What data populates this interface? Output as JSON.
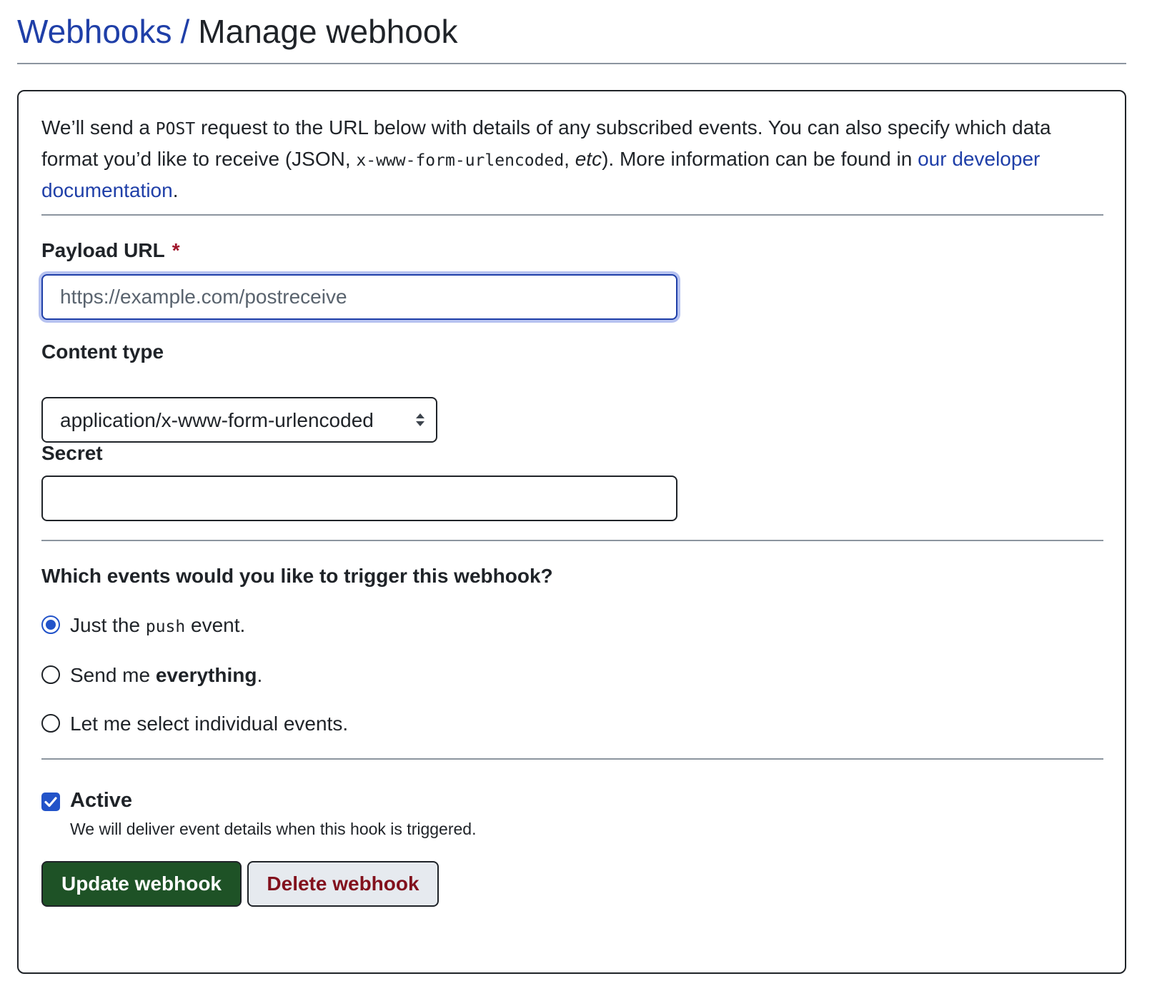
{
  "breadcrumb": {
    "parent": "Webhooks",
    "separator": "/",
    "current": "Manage webhook"
  },
  "intro": {
    "part1": "We’ll send a ",
    "code_method": "POST",
    "part2": " request to the URL below with details of any subscribed events. You can also specify which data format you’d like to receive (JSON, ",
    "code_format": "x-www-form-urlencoded",
    "part3": ", ",
    "etc": "etc",
    "part4": "). More information can be found in ",
    "link": "our developer documentation",
    "part5": "."
  },
  "payload_url": {
    "label": "Payload URL",
    "required_marker": "*",
    "placeholder": "https://example.com/postreceive",
    "value": ""
  },
  "content_type": {
    "label": "Content type",
    "selected": "application/x-www-form-urlencoded"
  },
  "secret": {
    "label": "Secret",
    "value": ""
  },
  "events": {
    "question": "Which events would you like to trigger this webhook?",
    "options": [
      {
        "pre": "Just the ",
        "code": "push",
        "post": " event.",
        "checked": true
      },
      {
        "pre": "Send me ",
        "bold": "everything",
        "post": ".",
        "checked": false
      },
      {
        "text": "Let me select individual events.",
        "checked": false
      }
    ]
  },
  "active": {
    "label": "Active",
    "description": "We will deliver event details when this hook is triggered.",
    "checked": true
  },
  "buttons": {
    "update": "Update webhook",
    "delete": "Delete webhook"
  },
  "colors": {
    "link": "#1f3fa8",
    "primary_button": "#1e5226",
    "danger_text": "#82111d",
    "accent": "#2253c9",
    "required": "#a0132a"
  },
  "icons": {
    "select_arrows": "chevron-up-down-icon",
    "checkbox_check": "check-icon"
  }
}
